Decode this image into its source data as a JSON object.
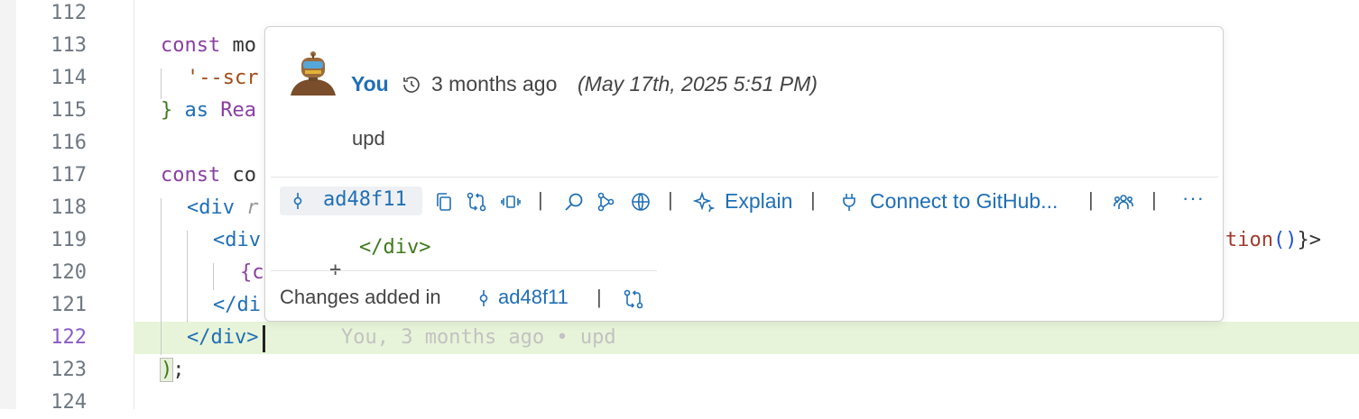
{
  "editor": {
    "line_numbers": [
      "112",
      "113",
      "114",
      "115",
      "116",
      "117",
      "118",
      "119",
      "120",
      "121",
      "122",
      "123",
      "124"
    ],
    "active_line": "122",
    "code": {
      "l113_kw": "const",
      "l113_rest": " mo",
      "l114_str": "'--scr",
      "l115_brace": "}",
      "l115_kw": " as",
      "l115_rest": " Rea",
      "l117_kw": "const",
      "l117_rest": " co",
      "l118_tag": "<div",
      "l118_rest": " r",
      "l119_tag": "<div",
      "l119_tail_ident": "tion",
      "l119_tail_paren": "()",
      "l119_tail_end": "}>",
      "l120": "{c",
      "l121": "</di",
      "l122": "</div>",
      "l123_paren": ")",
      "l123_end": ";"
    },
    "inline_blame": "You, 3 months ago • upd"
  },
  "hover": {
    "author": "You",
    "relative_time": "3 months ago",
    "absolute_time": "(May 17th, 2025 5:51 PM)",
    "message": "upd",
    "sha": "ad48f11",
    "actions": {
      "explain": "Explain",
      "connect": "Connect to GitHub...",
      "more": "···"
    },
    "diff": {
      "sign": "+",
      "code": "</div>"
    },
    "changes_label": "Changes added in",
    "changes_sha": "ad48f11",
    "separator": "|",
    "icons": [
      "history-icon",
      "commit-icon",
      "copy-icon",
      "compare-icon",
      "changes-icon",
      "search-icon",
      "graph-icon",
      "globe-icon",
      "sparkle-icon",
      "plug-icon",
      "team-icon",
      "more-icon"
    ]
  }
}
